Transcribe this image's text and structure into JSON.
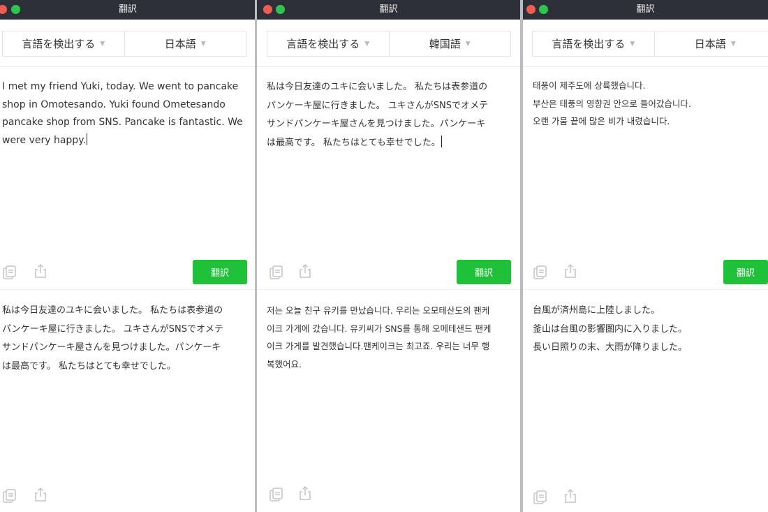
{
  "windows": [
    {
      "title": "翻訳",
      "source_lang": "言語を検出する",
      "target_lang": "日本語",
      "source_text": "I met my friend Yuki, today. We went to pancake\nshop in Omotesando. Yuki found Ometesando\npancake shop from SNS. Pancake is fantastic. We\nwere very happy.",
      "translate_label": "翻訳",
      "result_text": "私は今日友達のユキに会いました。 私たちは表参道の\nパンケーキ屋に行きました。 ユキさんがSNSでオメテ\nサンドパンケーキ屋さんを見つけました。パンケーキ\nは最高です。 私たちはとても幸せでした。"
    },
    {
      "title": "翻訳",
      "source_lang": "言語を検出する",
      "target_lang": "韓国語",
      "source_text": "私は今日友達のユキに会いました。 私たちは表参道の\nパンケーキ屋に行きました。 ユキさんがSNSでオメテ\nサンドパンケーキ屋さんを見つけました。パンケーキ\nは最高です。 私たちはとても幸せでした。",
      "translate_label": "翻訳",
      "result_text": "저는 오늘 친구 유키를 만났습니다. 우리는 오모테산도의 팬케\n이크 가게에 갔습니다. 유키씨가 SNS를 통해 오메테샌드 팬케\n이크 가게를 발견했습니다.팬케이크는 최고죠. 우리는 너무 행\n복했어요."
    },
    {
      "title": "翻訳",
      "source_lang": "言語を検出する",
      "target_lang": "日本語",
      "source_text": "태풍이 제주도에 상륙했습니다.\n부산은 태풍의 영향권 안으로 들어갔습니다.\n오랜 가뭄 끝에 많은 비가 내렸습니다.",
      "translate_label": "翻訳",
      "result_text": "台風が済州島に上陸しました。\n釜山は台風の影響圏内に入りました。\n長い日照りの末、大雨が降りました。"
    }
  ],
  "icons": {
    "copy": "copy-icon",
    "share": "share-icon",
    "dropdown": "chevron-down-icon"
  },
  "colors": {
    "titlebar": "#2d3039",
    "translate_button": "#1ec137",
    "close_light": "#ee5d53",
    "zoom_light": "#30c451"
  }
}
